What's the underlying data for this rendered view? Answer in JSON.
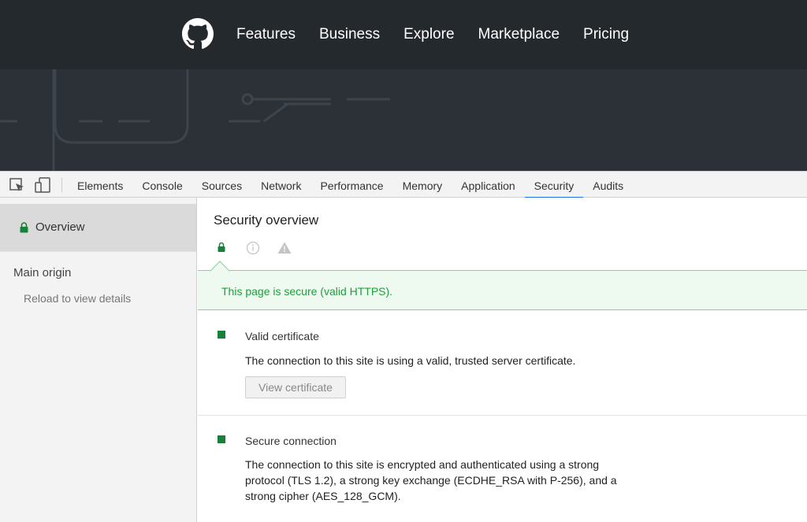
{
  "github": {
    "nav": [
      "Features",
      "Business",
      "Explore",
      "Marketplace",
      "Pricing"
    ]
  },
  "devtools": {
    "tabs": [
      "Elements",
      "Console",
      "Sources",
      "Network",
      "Performance",
      "Memory",
      "Application",
      "Security",
      "Audits"
    ],
    "active_tab": "Security"
  },
  "sidebar": {
    "overview_label": "Overview",
    "main_origin_label": "Main origin",
    "reload_hint": "Reload to view details"
  },
  "main": {
    "title": "Security overview",
    "banner": "This page is secure (valid HTTPS).",
    "sections": [
      {
        "title": "Valid certificate",
        "description": "The connection to this site is using a valid, trusted server certificate.",
        "button": "View certificate"
      },
      {
        "title": "Secure connection",
        "description": "The connection to this site is encrypted and authenticated using a strong protocol (TLS 1.2), a strong key exchange (ECDHE_RSA with P-256), and a strong cipher (AES_128_GCM)."
      }
    ]
  },
  "colors": {
    "header_bg": "#24292e",
    "secure_green": "#188038",
    "banner_text": "#1e9e3c",
    "banner_bg": "#eefaf0",
    "active_tab_underline": "#1a73e8"
  }
}
